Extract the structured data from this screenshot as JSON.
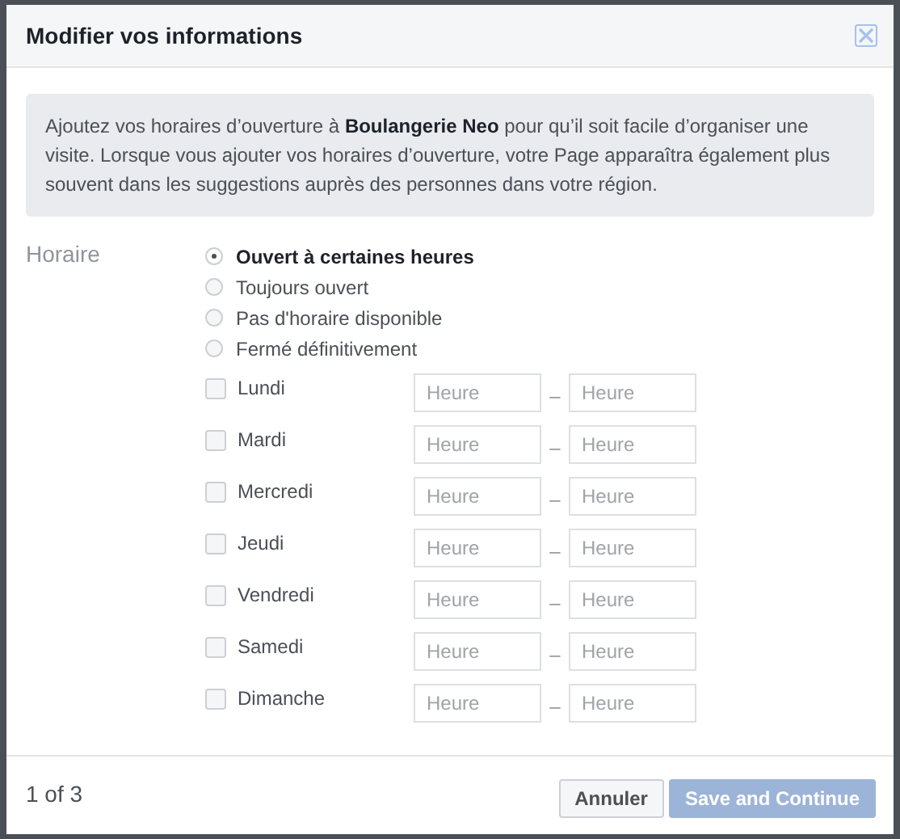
{
  "dialog": {
    "title": "Modifier vos informations",
    "info": "Ajoutez vos horaires d’ouverture à **Boulangerie Neo** pour qu’il soit facile d’organiser une visite. Lorsque vous ajouter vos horaires d’ouverture, votre Page apparaîtra également plus souvent dans les suggestions auprès des personnes dans votre région."
  },
  "hours": {
    "label": "Horaire",
    "options": [
      {
        "label": "Ouvert à certaines heures",
        "selected": true
      },
      {
        "label": "Toujours ouvert",
        "selected": false
      },
      {
        "label": "Pas d'horaire disponible",
        "selected": false
      },
      {
        "label": "Fermé définitivement",
        "selected": false
      }
    ],
    "days": [
      {
        "name": "Lundi",
        "checked": false,
        "from_placeholder": "Heure",
        "separator": "–",
        "to_placeholder": "Heure"
      },
      {
        "name": "Mardi",
        "checked": false,
        "from_placeholder": "Heure",
        "separator": "–",
        "to_placeholder": "Heure"
      },
      {
        "name": "Mercredi",
        "checked": false,
        "from_placeholder": "Heure",
        "separator": "–",
        "to_placeholder": "Heure"
      },
      {
        "name": "Jeudi",
        "checked": false,
        "from_placeholder": "Heure",
        "separator": "–",
        "to_placeholder": "Heure"
      },
      {
        "name": "Vendredi",
        "checked": false,
        "from_placeholder": "Heure",
        "separator": "–",
        "to_placeholder": "Heure"
      },
      {
        "name": "Samedi",
        "checked": false,
        "from_placeholder": "Heure",
        "separator": "–",
        "to_placeholder": "Heure"
      },
      {
        "name": "Dimanche",
        "checked": false,
        "from_placeholder": "Heure",
        "separator": "–",
        "to_placeholder": "Heure"
      }
    ]
  },
  "footer": {
    "step": "1 of 3",
    "buttons": [
      {
        "label": "Annuler",
        "kind": "secondary",
        "disabled": false
      },
      {
        "label": "Save and Continue",
        "kind": "primary",
        "disabled": true
      }
    ]
  }
}
